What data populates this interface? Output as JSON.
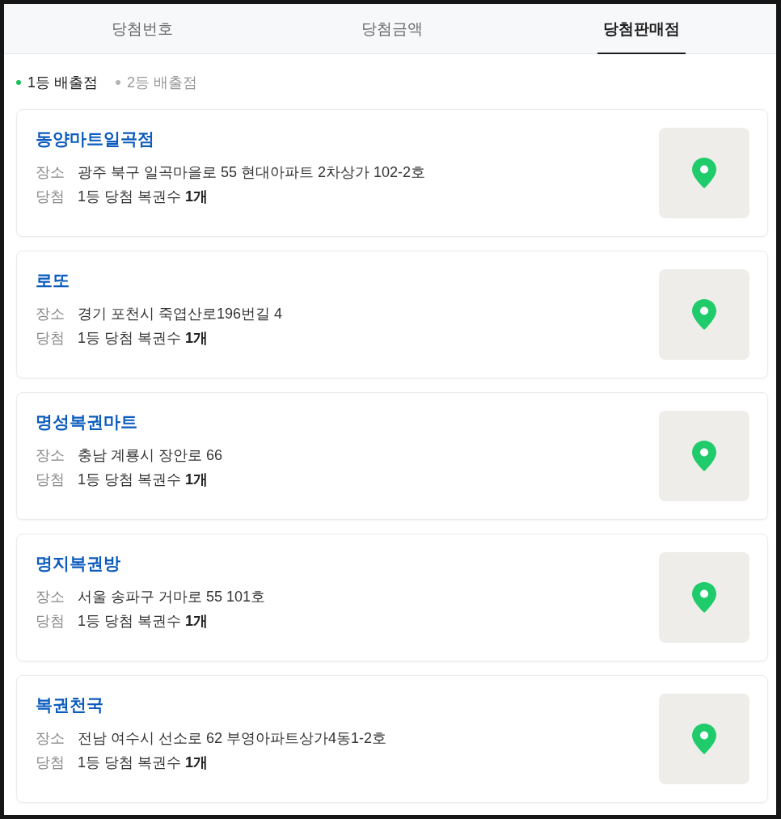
{
  "tabs": [
    {
      "label": "당첨번호",
      "selected": false
    },
    {
      "label": "당첨금액",
      "selected": false
    },
    {
      "label": "당첨판매점",
      "selected": true
    }
  ],
  "filters": [
    {
      "label": "1등 배출점",
      "selected": true
    },
    {
      "label": "2등 배출점",
      "selected": false
    }
  ],
  "stores": [
    {
      "name": "동양마트일곡점",
      "fields": [
        {
          "label": "장소",
          "value": "광주 북구 일곡마을로 55 현대아파트 2차상가 102-2호"
        },
        {
          "label": "당첨",
          "value": "1등 당첨 복권수 **1개**"
        }
      ]
    },
    {
      "name": "로또",
      "fields": [
        {
          "label": "장소",
          "value": "경기 포천시 죽엽산로196번길 4"
        },
        {
          "label": "당첨",
          "value": "1등 당첨 복권수 **1개**"
        }
      ]
    },
    {
      "name": "명성복권마트",
      "fields": [
        {
          "label": "장소",
          "value": "충남 계룡시 장안로 66"
        },
        {
          "label": "당첨",
          "value": "1등 당첨 복권수 **1개**"
        }
      ]
    },
    {
      "name": "명지복권방",
      "fields": [
        {
          "label": "장소",
          "value": "서울 송파구 거마로 55 101호"
        },
        {
          "label": "당첨",
          "value": "1등 당첨 복권수 **1개**"
        }
      ]
    },
    {
      "name": "복권천국",
      "fields": [
        {
          "label": "장소",
          "value": "전남 여수시 선소로 62 부영아파트상가4동1-2호"
        },
        {
          "label": "당첨",
          "value": "1등 당첨 복권수 **1개**"
        }
      ]
    }
  ]
}
